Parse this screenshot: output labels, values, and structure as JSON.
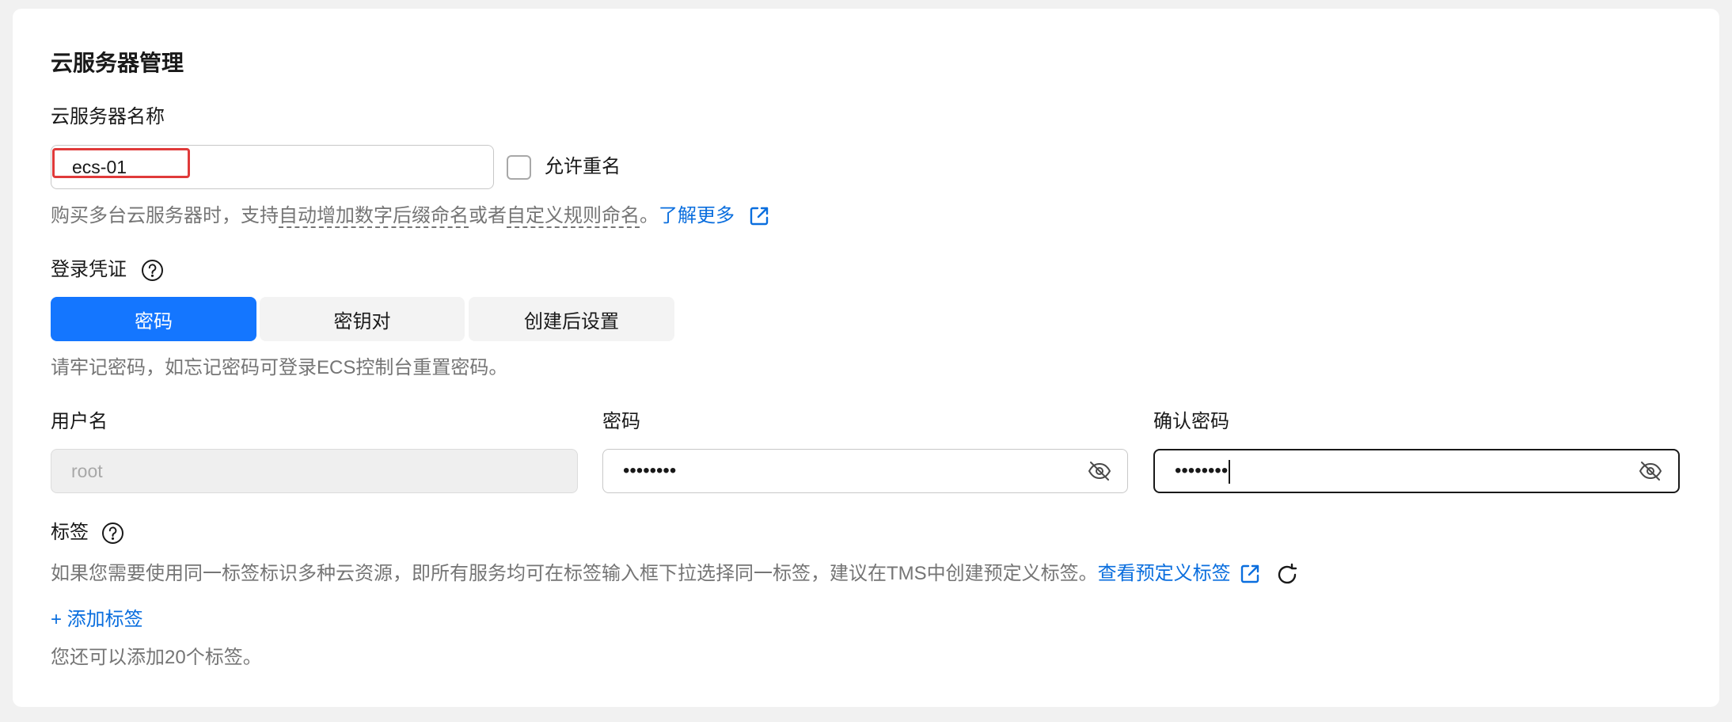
{
  "section_title": "云服务器管理",
  "server_name": {
    "label": "云服务器名称",
    "value": "ecs-01",
    "allow_duplicate_label": "允许重名",
    "allow_duplicate_checked": false,
    "hint_prefix": "购买多台云服务器时，支持",
    "hint_term1": "自动增加数字后缀命名",
    "hint_mid": "或者",
    "hint_term2": "自定义规则命名",
    "hint_suffix": "。",
    "learn_more": "了解更多"
  },
  "login_credential": {
    "label": "登录凭证",
    "tabs": [
      {
        "label": "密码",
        "active": true
      },
      {
        "label": "密钥对",
        "active": false
      },
      {
        "label": "创建后设置",
        "active": false
      }
    ],
    "hint": "请牢记密码，如忘记密码可登录ECS控制台重置密码。"
  },
  "credentials": {
    "username_label": "用户名",
    "username_value": "root",
    "password_label": "密码",
    "password_value": "••••••••",
    "confirm_label": "确认密码",
    "confirm_value": "••••••••"
  },
  "tags": {
    "label": "标签",
    "hint": "如果您需要使用同一标签标识多种云资源，即所有服务均可在标签输入框下拉选择同一标签，建议在TMS中创建预定义标签。",
    "view_predefined": "查看预定义标签",
    "add_tag": "+ 添加标签",
    "remaining": "您还可以添加20个标签。"
  },
  "colors": {
    "accent": "#1476ff",
    "link": "#0a6ede",
    "highlight_box": "#e03a3a"
  },
  "icons": [
    "help-icon",
    "external-link-icon",
    "eye-off-icon",
    "refresh-icon"
  ]
}
